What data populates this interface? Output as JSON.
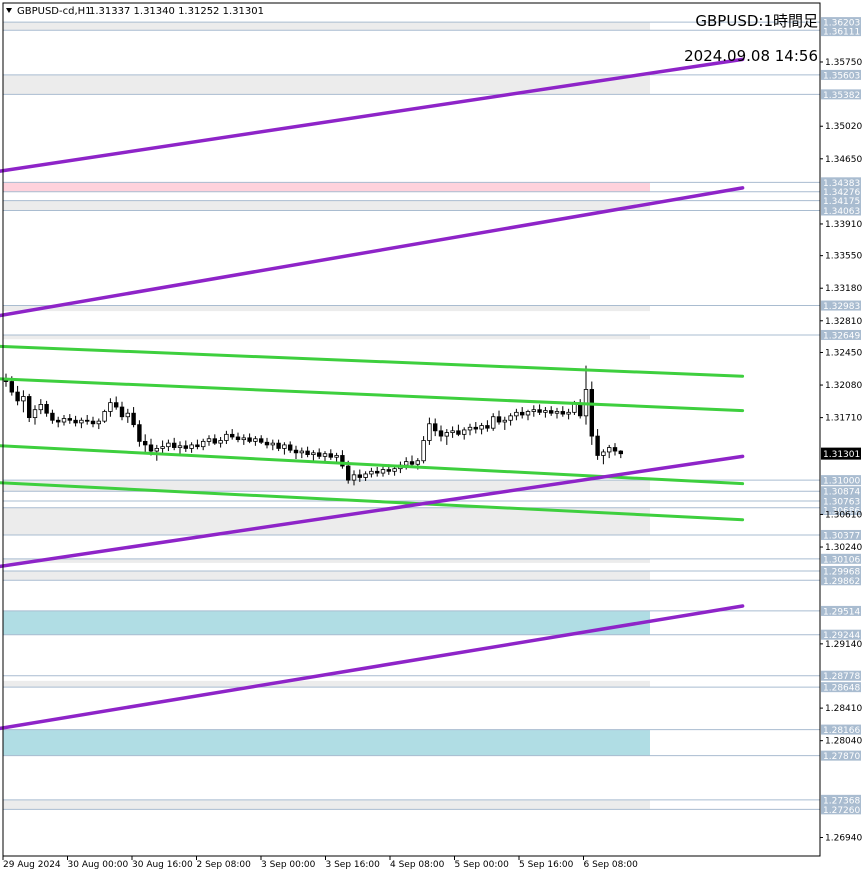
{
  "header": {
    "symbol": "GBPUSD-cd,H1",
    "ohlc": "1.31337 1.31340 1.31252 1.31301",
    "title": "GBPUSD:1時間足",
    "datetime": "2024.09.08 14:56"
  },
  "colors": {
    "background": "#ffffff",
    "trend_line": "#8e24c8",
    "channel_line": "#3ecf3e",
    "zone_gray": "#ececec",
    "zone_pink": "#ffd2dc",
    "zone_blue": "#b0dde4",
    "level_line": "#a9bcd0",
    "level_label_bg": "#a9bcd0",
    "candle": "#000000",
    "current_price_bg": "#000000"
  },
  "chart_data": {
    "type": "candlestick",
    "ylim": [
      1.2673,
      1.3642
    ],
    "y_ticks": [
      "1.35750",
      "1.35020",
      "1.34650",
      "1.33910",
      "1.33550",
      "1.33180",
      "1.32810",
      "1.32450",
      "1.32080",
      "1.31710",
      "1.30610",
      "1.30240",
      "1.29140",
      "1.28410",
      "1.28040",
      "1.26940"
    ],
    "x_labels": [
      "29 Aug 2024",
      "30 Aug 00:00",
      "30 Aug 16:00",
      "2 Sep 08:00",
      "3 Sep 00:00",
      "3 Sep 16:00",
      "4 Sep 08:00",
      "5 Sep 00:00",
      "5 Sep 16:00",
      "6 Sep 08:00"
    ],
    "current_price": "1.31301",
    "levels": [
      "1.36203",
      "1.36111",
      "1.35603",
      "1.35382",
      "1.34383",
      "1.34276",
      "1.34175",
      "1.34063",
      "1.32983",
      "1.32649",
      "1.31000",
      "1.30874",
      "1.30763",
      "1.30686",
      "1.30377",
      "1.30106",
      "1.29968",
      "1.29862",
      "1.29514",
      "1.29244",
      "1.28778",
      "1.28648",
      "1.28166",
      "1.27870",
      "1.27368",
      "1.27260"
    ],
    "zones": [
      {
        "from": 1.36111,
        "to": 1.36203,
        "style": "gray"
      },
      {
        "from": 1.35382,
        "to": 1.35603,
        "style": "gray"
      },
      {
        "from": 1.34276,
        "to": 1.34383,
        "style": "pink"
      },
      {
        "from": 1.34063,
        "to": 1.34175,
        "style": "gray"
      },
      {
        "from": 1.3292,
        "to": 1.32983,
        "style": "gray"
      },
      {
        "from": 1.326,
        "to": 1.32649,
        "style": "gray"
      },
      {
        "from": 1.30874,
        "to": 1.31,
        "style": "gray"
      },
      {
        "from": 1.30377,
        "to": 1.30686,
        "style": "gray"
      },
      {
        "from": 1.3006,
        "to": 1.30106,
        "style": "gray"
      },
      {
        "from": 1.29862,
        "to": 1.29968,
        "style": "gray"
      },
      {
        "from": 1.29244,
        "to": 1.29514,
        "style": "blue"
      },
      {
        "from": 1.28648,
        "to": 1.2872,
        "style": "gray"
      },
      {
        "from": 1.2787,
        "to": 1.28166,
        "style": "blue"
      },
      {
        "from": 1.2726,
        "to": 1.27368,
        "style": "gray"
      }
    ],
    "trend_lines": [
      {
        "x0": 0,
        "y0": 1.3451,
        "x1": 127,
        "y1": 1.3578
      },
      {
        "x0": 0,
        "y0": 1.3287,
        "x1": 127,
        "y1": 1.3432
      },
      {
        "x0": 0,
        "y0": 1.3002,
        "x1": 127,
        "y1": 1.3127
      },
      {
        "x0": 0,
        "y0": 1.2818,
        "x1": 127,
        "y1": 1.2957
      }
    ],
    "channel_lines": [
      {
        "x0": 0,
        "y0": 1.3252,
        "x1": 127,
        "y1": 1.3218
      },
      {
        "x0": 0,
        "y0": 1.3215,
        "x1": 127,
        "y1": 1.3179
      },
      {
        "x0": 0,
        "y0": 1.3139,
        "x1": 127,
        "y1": 1.3096
      },
      {
        "x0": 0,
        "y0": 1.3097,
        "x1": 127,
        "y1": 1.3055
      }
    ],
    "candles": [
      [
        1.3215,
        1.3221,
        1.3206,
        1.3212
      ],
      [
        1.3212,
        1.3218,
        1.3196,
        1.32
      ],
      [
        1.32,
        1.3207,
        1.3185,
        1.319
      ],
      [
        1.319,
        1.3202,
        1.3177,
        1.3195
      ],
      [
        1.3195,
        1.3198,
        1.3166,
        1.3171
      ],
      [
        1.3171,
        1.3185,
        1.3163,
        1.318
      ],
      [
        1.318,
        1.3192,
        1.3175,
        1.3186
      ],
      [
        1.3186,
        1.319,
        1.3172,
        1.3176
      ],
      [
        1.3176,
        1.318,
        1.3164,
        1.3168
      ],
      [
        1.3168,
        1.3172,
        1.316,
        1.3166
      ],
      [
        1.3166,
        1.3174,
        1.3162,
        1.317
      ],
      [
        1.317,
        1.3175,
        1.3164,
        1.3168
      ],
      [
        1.3168,
        1.3173,
        1.3161,
        1.3165
      ],
      [
        1.3165,
        1.3171,
        1.3159,
        1.3168
      ],
      [
        1.3168,
        1.3174,
        1.3163,
        1.3167
      ],
      [
        1.3167,
        1.3172,
        1.316,
        1.3164
      ],
      [
        1.3164,
        1.317,
        1.3158,
        1.3167
      ],
      [
        1.3167,
        1.318,
        1.3165,
        1.3178
      ],
      [
        1.3178,
        1.3193,
        1.3172,
        1.3188
      ],
      [
        1.3188,
        1.3195,
        1.318,
        1.3183
      ],
      [
        1.3183,
        1.3189,
        1.3168,
        1.3172
      ],
      [
        1.3172,
        1.3181,
        1.3165,
        1.3176
      ],
      [
        1.3176,
        1.3183,
        1.316,
        1.3163
      ],
      [
        1.3163,
        1.3168,
        1.3138,
        1.3144
      ],
      [
        1.3144,
        1.3152,
        1.3132,
        1.314
      ],
      [
        1.314,
        1.3147,
        1.3128,
        1.3133
      ],
      [
        1.3133,
        1.314,
        1.3122,
        1.3136
      ],
      [
        1.3136,
        1.3145,
        1.313,
        1.3138
      ],
      [
        1.3138,
        1.3146,
        1.3133,
        1.3142
      ],
      [
        1.3142,
        1.3148,
        1.3134,
        1.3137
      ],
      [
        1.3137,
        1.3144,
        1.313,
        1.3139
      ],
      [
        1.3139,
        1.3145,
        1.3132,
        1.3136
      ],
      [
        1.3136,
        1.3143,
        1.3131,
        1.314
      ],
      [
        1.314,
        1.3146,
        1.3135,
        1.3138
      ],
      [
        1.3138,
        1.3147,
        1.3134,
        1.3144
      ],
      [
        1.3144,
        1.3151,
        1.3139,
        1.3147
      ],
      [
        1.3147,
        1.3152,
        1.314,
        1.3142
      ],
      [
        1.3142,
        1.3149,
        1.3137,
        1.3145
      ],
      [
        1.3145,
        1.3156,
        1.3141,
        1.3152
      ],
      [
        1.3152,
        1.3158,
        1.3146,
        1.3149
      ],
      [
        1.3149,
        1.3154,
        1.3143,
        1.3146
      ],
      [
        1.3146,
        1.3152,
        1.314,
        1.3148
      ],
      [
        1.3148,
        1.3153,
        1.3142,
        1.3144
      ],
      [
        1.3144,
        1.315,
        1.3139,
        1.3147
      ],
      [
        1.3147,
        1.3151,
        1.3141,
        1.3143
      ],
      [
        1.3143,
        1.3148,
        1.3136,
        1.314
      ],
      [
        1.314,
        1.3146,
        1.3134,
        1.3142
      ],
      [
        1.3142,
        1.3146,
        1.3133,
        1.3136
      ],
      [
        1.3136,
        1.3143,
        1.3129,
        1.314
      ],
      [
        1.314,
        1.3144,
        1.3131,
        1.3134
      ],
      [
        1.3134,
        1.3139,
        1.3124,
        1.3131
      ],
      [
        1.3131,
        1.3137,
        1.3125,
        1.3133
      ],
      [
        1.3133,
        1.3138,
        1.3126,
        1.3129
      ],
      [
        1.3129,
        1.3134,
        1.3122,
        1.3131
      ],
      [
        1.3131,
        1.3136,
        1.3124,
        1.3127
      ],
      [
        1.3127,
        1.3133,
        1.3121,
        1.313
      ],
      [
        1.313,
        1.3135,
        1.3123,
        1.3126
      ],
      [
        1.3126,
        1.3131,
        1.312,
        1.3128
      ],
      [
        1.3128,
        1.3134,
        1.3113,
        1.3116
      ],
      [
        1.3116,
        1.3122,
        1.3096,
        1.31
      ],
      [
        1.31,
        1.3111,
        1.3094,
        1.3106
      ],
      [
        1.3106,
        1.3112,
        1.3098,
        1.3103
      ],
      [
        1.3103,
        1.311,
        1.3099,
        1.3107
      ],
      [
        1.3107,
        1.3114,
        1.3103,
        1.311
      ],
      [
        1.311,
        1.3115,
        1.3104,
        1.3108
      ],
      [
        1.3108,
        1.3116,
        1.3104,
        1.3112
      ],
      [
        1.3112,
        1.3118,
        1.3106,
        1.311
      ],
      [
        1.311,
        1.3117,
        1.3105,
        1.3113
      ],
      [
        1.3113,
        1.3121,
        1.3108,
        1.3117
      ],
      [
        1.3117,
        1.3126,
        1.3112,
        1.3121
      ],
      [
        1.3121,
        1.3128,
        1.3114,
        1.3118
      ],
      [
        1.3118,
        1.3125,
        1.3112,
        1.3122
      ],
      [
        1.3122,
        1.315,
        1.3119,
        1.3145
      ],
      [
        1.3145,
        1.3171,
        1.314,
        1.3164
      ],
      [
        1.3164,
        1.317,
        1.315,
        1.3156
      ],
      [
        1.3156,
        1.3162,
        1.3144,
        1.315
      ],
      [
        1.315,
        1.3158,
        1.314,
        1.3154
      ],
      [
        1.3154,
        1.3161,
        1.3148,
        1.3156
      ],
      [
        1.3156,
        1.3163,
        1.315,
        1.3152
      ],
      [
        1.3152,
        1.316,
        1.3146,
        1.3157
      ],
      [
        1.3157,
        1.3164,
        1.3151,
        1.316
      ],
      [
        1.316,
        1.3166,
        1.3153,
        1.3158
      ],
      [
        1.3158,
        1.3165,
        1.3152,
        1.3162
      ],
      [
        1.3162,
        1.3168,
        1.3155,
        1.3159
      ],
      [
        1.3159,
        1.3176,
        1.3156,
        1.3172
      ],
      [
        1.3172,
        1.3179,
        1.3163,
        1.3166
      ],
      [
        1.3166,
        1.3172,
        1.3157,
        1.3168
      ],
      [
        1.3168,
        1.3176,
        1.3162,
        1.3173
      ],
      [
        1.3173,
        1.3181,
        1.3168,
        1.3177
      ],
      [
        1.3177,
        1.3183,
        1.317,
        1.3174
      ],
      [
        1.3174,
        1.318,
        1.3168,
        1.3178
      ],
      [
        1.3178,
        1.3185,
        1.3172,
        1.318
      ],
      [
        1.318,
        1.3186,
        1.3174,
        1.3177
      ],
      [
        1.3177,
        1.3183,
        1.3171,
        1.3179
      ],
      [
        1.3179,
        1.3184,
        1.3173,
        1.3176
      ],
      [
        1.3176,
        1.3182,
        1.317,
        1.3178
      ],
      [
        1.3178,
        1.3184,
        1.3172,
        1.3175
      ],
      [
        1.3175,
        1.3181,
        1.3169,
        1.3177
      ],
      [
        1.3177,
        1.319,
        1.3174,
        1.3187
      ],
      [
        1.3187,
        1.3192,
        1.317,
        1.3173
      ],
      [
        1.3173,
        1.323,
        1.3163,
        1.3203
      ],
      [
        1.3203,
        1.3212,
        1.314,
        1.315
      ],
      [
        1.315,
        1.3158,
        1.3123,
        1.3128
      ],
      [
        1.3128,
        1.3135,
        1.3118,
        1.3132
      ],
      [
        1.3132,
        1.314,
        1.3125,
        1.3137
      ],
      [
        1.3137,
        1.3142,
        1.3128,
        1.3133
      ],
      [
        1.3133,
        1.3134,
        1.3125,
        1.313
      ]
    ]
  }
}
